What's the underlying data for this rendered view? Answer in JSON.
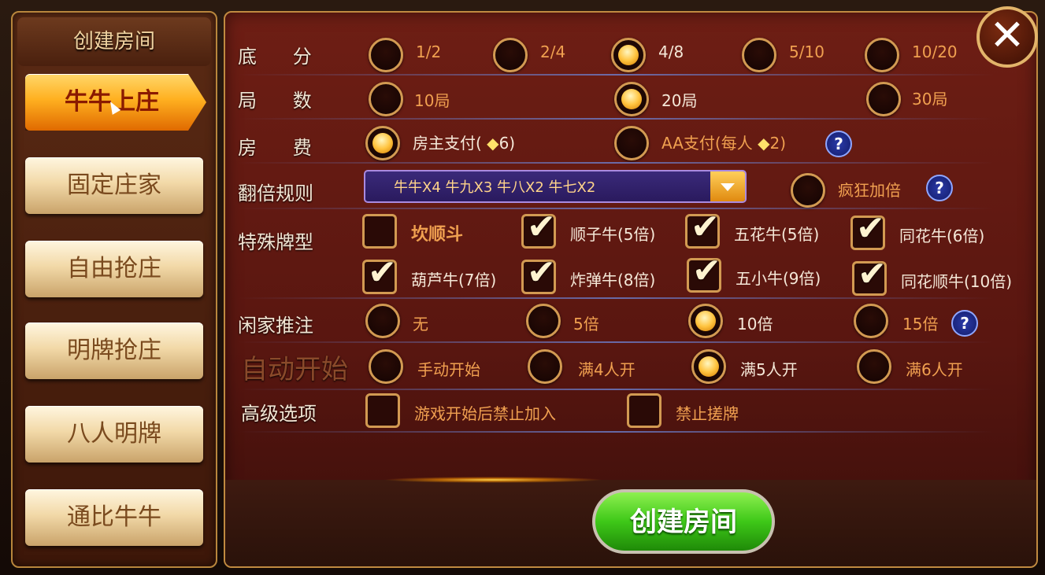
{
  "sidebar": {
    "title": "创建房间",
    "modes": [
      "牛牛上庄",
      "固定庄家",
      "自由抢庄",
      "明牌抢庄",
      "八人明牌",
      "通比牛牛"
    ],
    "active_index": 0
  },
  "rows": {
    "base": {
      "label": "底      分",
      "options": [
        "1/2",
        "2/4",
        "4/8",
        "5/10",
        "10/20"
      ],
      "selected": "4/8"
    },
    "rounds": {
      "label": "局      数",
      "options": [
        "10局",
        "20局",
        "30局"
      ],
      "selected": "20局"
    },
    "fee": {
      "label": "房      费",
      "owner_pay": "房主支付(",
      "owner_count": "6)",
      "aa_pay": "AA支付(每人",
      "aa_count": "2)",
      "selected": "房主支付"
    },
    "double_rule": {
      "label": "翻倍规则",
      "value": "牛牛X4   牛九X3   牛八X2   牛七X2",
      "crazy": "疯狂加倍",
      "crazy_checked": false
    },
    "special": {
      "label": "特殊牌型",
      "items": [
        {
          "text": "坎顺斗",
          "checked": false
        },
        {
          "text": "顺子牛(5倍)",
          "checked": true
        },
        {
          "text": "五花牛(5倍)",
          "checked": true
        },
        {
          "text": "同花牛(6倍)",
          "checked": true
        },
        {
          "text": "葫芦牛(7倍)",
          "checked": true
        },
        {
          "text": "炸弹牛(8倍)",
          "checked": true
        },
        {
          "text": "五小牛(9倍)",
          "checked": true
        },
        {
          "text": "同花顺牛(10倍)",
          "checked": true
        }
      ]
    },
    "push": {
      "label": "闲家推注",
      "options": [
        "无",
        "5倍",
        "10倍",
        "15倍"
      ],
      "selected": "10倍"
    },
    "auto_start": {
      "label": "自动开始",
      "options": [
        "手动开始",
        "满4人开",
        "满5人开",
        "满6人开"
      ],
      "selected": "满5人开"
    },
    "advanced": {
      "label": "高级选项",
      "options": [
        "游戏开始后禁止加入",
        "禁止搓牌"
      ]
    }
  },
  "buttons": {
    "create": "创建房间",
    "close": "✕",
    "help": "?"
  },
  "colors": {
    "accent": "#ffb020",
    "green": "#3ec818",
    "panel": "#6e1e14"
  }
}
